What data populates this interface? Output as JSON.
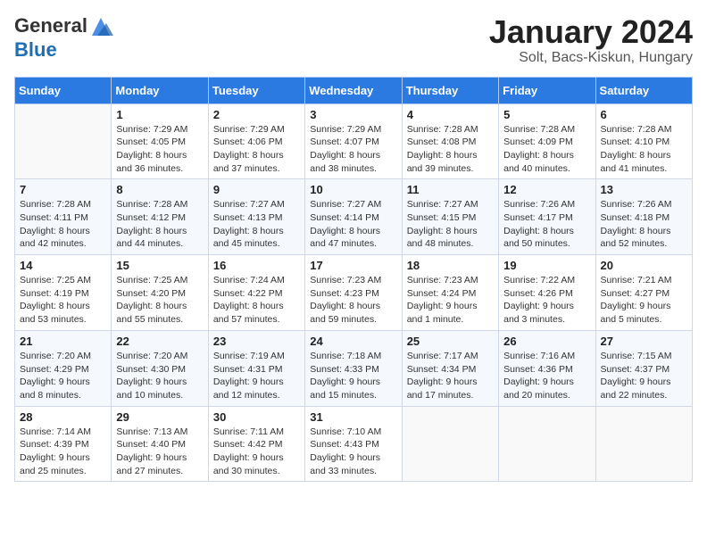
{
  "header": {
    "logo_line1": "General",
    "logo_line2": "Blue",
    "month_title": "January 2024",
    "location": "Solt, Bacs-Kiskun, Hungary"
  },
  "weekdays": [
    "Sunday",
    "Monday",
    "Tuesday",
    "Wednesday",
    "Thursday",
    "Friday",
    "Saturday"
  ],
  "weeks": [
    [
      {
        "day": "",
        "info": ""
      },
      {
        "day": "1",
        "info": "Sunrise: 7:29 AM\nSunset: 4:05 PM\nDaylight: 8 hours\nand 36 minutes."
      },
      {
        "day": "2",
        "info": "Sunrise: 7:29 AM\nSunset: 4:06 PM\nDaylight: 8 hours\nand 37 minutes."
      },
      {
        "day": "3",
        "info": "Sunrise: 7:29 AM\nSunset: 4:07 PM\nDaylight: 8 hours\nand 38 minutes."
      },
      {
        "day": "4",
        "info": "Sunrise: 7:28 AM\nSunset: 4:08 PM\nDaylight: 8 hours\nand 39 minutes."
      },
      {
        "day": "5",
        "info": "Sunrise: 7:28 AM\nSunset: 4:09 PM\nDaylight: 8 hours\nand 40 minutes."
      },
      {
        "day": "6",
        "info": "Sunrise: 7:28 AM\nSunset: 4:10 PM\nDaylight: 8 hours\nand 41 minutes."
      }
    ],
    [
      {
        "day": "7",
        "info": "Sunrise: 7:28 AM\nSunset: 4:11 PM\nDaylight: 8 hours\nand 42 minutes."
      },
      {
        "day": "8",
        "info": "Sunrise: 7:28 AM\nSunset: 4:12 PM\nDaylight: 8 hours\nand 44 minutes."
      },
      {
        "day": "9",
        "info": "Sunrise: 7:27 AM\nSunset: 4:13 PM\nDaylight: 8 hours\nand 45 minutes."
      },
      {
        "day": "10",
        "info": "Sunrise: 7:27 AM\nSunset: 4:14 PM\nDaylight: 8 hours\nand 47 minutes."
      },
      {
        "day": "11",
        "info": "Sunrise: 7:27 AM\nSunset: 4:15 PM\nDaylight: 8 hours\nand 48 minutes."
      },
      {
        "day": "12",
        "info": "Sunrise: 7:26 AM\nSunset: 4:17 PM\nDaylight: 8 hours\nand 50 minutes."
      },
      {
        "day": "13",
        "info": "Sunrise: 7:26 AM\nSunset: 4:18 PM\nDaylight: 8 hours\nand 52 minutes."
      }
    ],
    [
      {
        "day": "14",
        "info": "Sunrise: 7:25 AM\nSunset: 4:19 PM\nDaylight: 8 hours\nand 53 minutes."
      },
      {
        "day": "15",
        "info": "Sunrise: 7:25 AM\nSunset: 4:20 PM\nDaylight: 8 hours\nand 55 minutes."
      },
      {
        "day": "16",
        "info": "Sunrise: 7:24 AM\nSunset: 4:22 PM\nDaylight: 8 hours\nand 57 minutes."
      },
      {
        "day": "17",
        "info": "Sunrise: 7:23 AM\nSunset: 4:23 PM\nDaylight: 8 hours\nand 59 minutes."
      },
      {
        "day": "18",
        "info": "Sunrise: 7:23 AM\nSunset: 4:24 PM\nDaylight: 9 hours\nand 1 minute."
      },
      {
        "day": "19",
        "info": "Sunrise: 7:22 AM\nSunset: 4:26 PM\nDaylight: 9 hours\nand 3 minutes."
      },
      {
        "day": "20",
        "info": "Sunrise: 7:21 AM\nSunset: 4:27 PM\nDaylight: 9 hours\nand 5 minutes."
      }
    ],
    [
      {
        "day": "21",
        "info": "Sunrise: 7:20 AM\nSunset: 4:29 PM\nDaylight: 9 hours\nand 8 minutes."
      },
      {
        "day": "22",
        "info": "Sunrise: 7:20 AM\nSunset: 4:30 PM\nDaylight: 9 hours\nand 10 minutes."
      },
      {
        "day": "23",
        "info": "Sunrise: 7:19 AM\nSunset: 4:31 PM\nDaylight: 9 hours\nand 12 minutes."
      },
      {
        "day": "24",
        "info": "Sunrise: 7:18 AM\nSunset: 4:33 PM\nDaylight: 9 hours\nand 15 minutes."
      },
      {
        "day": "25",
        "info": "Sunrise: 7:17 AM\nSunset: 4:34 PM\nDaylight: 9 hours\nand 17 minutes."
      },
      {
        "day": "26",
        "info": "Sunrise: 7:16 AM\nSunset: 4:36 PM\nDaylight: 9 hours\nand 20 minutes."
      },
      {
        "day": "27",
        "info": "Sunrise: 7:15 AM\nSunset: 4:37 PM\nDaylight: 9 hours\nand 22 minutes."
      }
    ],
    [
      {
        "day": "28",
        "info": "Sunrise: 7:14 AM\nSunset: 4:39 PM\nDaylight: 9 hours\nand 25 minutes."
      },
      {
        "day": "29",
        "info": "Sunrise: 7:13 AM\nSunset: 4:40 PM\nDaylight: 9 hours\nand 27 minutes."
      },
      {
        "day": "30",
        "info": "Sunrise: 7:11 AM\nSunset: 4:42 PM\nDaylight: 9 hours\nand 30 minutes."
      },
      {
        "day": "31",
        "info": "Sunrise: 7:10 AM\nSunset: 4:43 PM\nDaylight: 9 hours\nand 33 minutes."
      },
      {
        "day": "",
        "info": ""
      },
      {
        "day": "",
        "info": ""
      },
      {
        "day": "",
        "info": ""
      }
    ]
  ]
}
